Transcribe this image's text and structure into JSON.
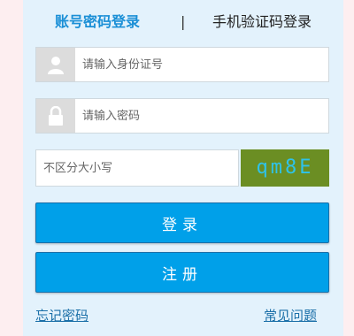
{
  "tabs": {
    "account_login": "账号密码登录",
    "separator": "|",
    "sms_login": "手机验证码登录"
  },
  "form": {
    "id_placeholder": "请输入身份证号",
    "password_placeholder": "请输入密码",
    "captcha_placeholder": "不区分大小写",
    "captcha_text": "qm8E"
  },
  "buttons": {
    "login": "登录",
    "register": "注册"
  },
  "links": {
    "forgot_password": "忘记密码",
    "faq": "常见问题"
  },
  "colors": {
    "accent": "#00a0e9",
    "active_tab": "#1a8fd6",
    "captcha_bg": "#6b8e23",
    "captcha_fg": "#2ec3ea",
    "panel_bg": "#e3f2fc"
  },
  "icons": {
    "id_field": "user-icon",
    "password_field": "lock-icon"
  }
}
